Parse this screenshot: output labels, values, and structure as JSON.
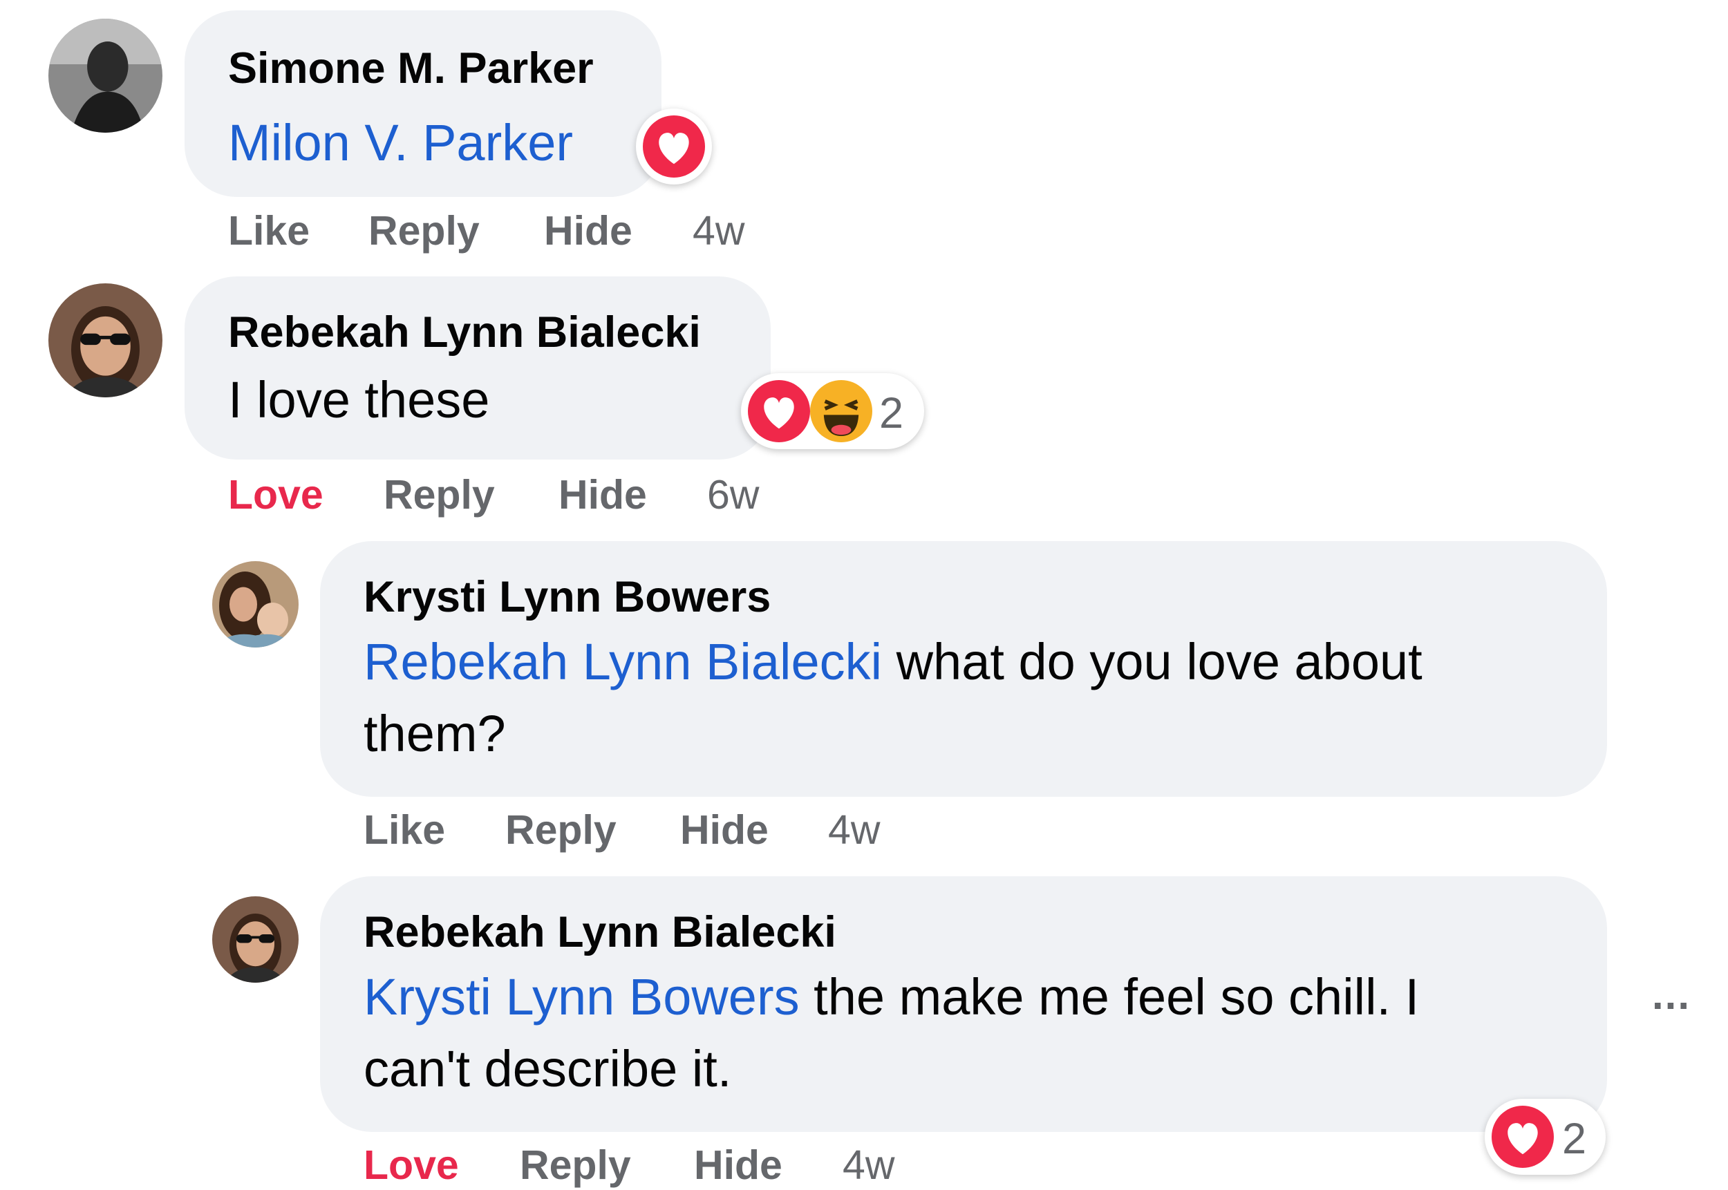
{
  "comments": [
    {
      "author": "Simone M. Parker",
      "mention": "Milon V. Parker",
      "text": "",
      "actions": {
        "first": "Like",
        "reply": "Reply",
        "hide": "Hide",
        "time": "4w"
      },
      "reactions": {
        "types": [
          "love"
        ],
        "count": ""
      }
    },
    {
      "author": "Rebekah Lynn Bialecki",
      "mention": "",
      "text": "I love these",
      "actions": {
        "first": "Love",
        "reply": "Reply",
        "hide": "Hide",
        "time": "6w"
      },
      "reactions": {
        "types": [
          "love",
          "haha"
        ],
        "count": "2"
      }
    },
    {
      "author": "Krysti Lynn Bowers",
      "mention": "Rebekah Lynn Bialecki",
      "text_line1": " what do you love about",
      "text_line2": "them?",
      "actions": {
        "first": "Like",
        "reply": "Reply",
        "hide": "Hide",
        "time": "4w"
      }
    },
    {
      "author": "Rebekah Lynn Bialecki",
      "mention": "Krysti Lynn Bowers",
      "text_line1": " the make me feel so chill. I",
      "text_line2": "can't describe it.",
      "actions": {
        "first": "Love",
        "reply": "Reply",
        "hide": "Hide",
        "time": "4w"
      },
      "reactions": {
        "types": [
          "love"
        ],
        "count": "2"
      }
    }
  ],
  "more_menu": "...",
  "colors": {
    "bubble": "#f0f2f5",
    "mention": "#1d5fd0",
    "love": "#e8284c",
    "muted": "#65676b"
  }
}
